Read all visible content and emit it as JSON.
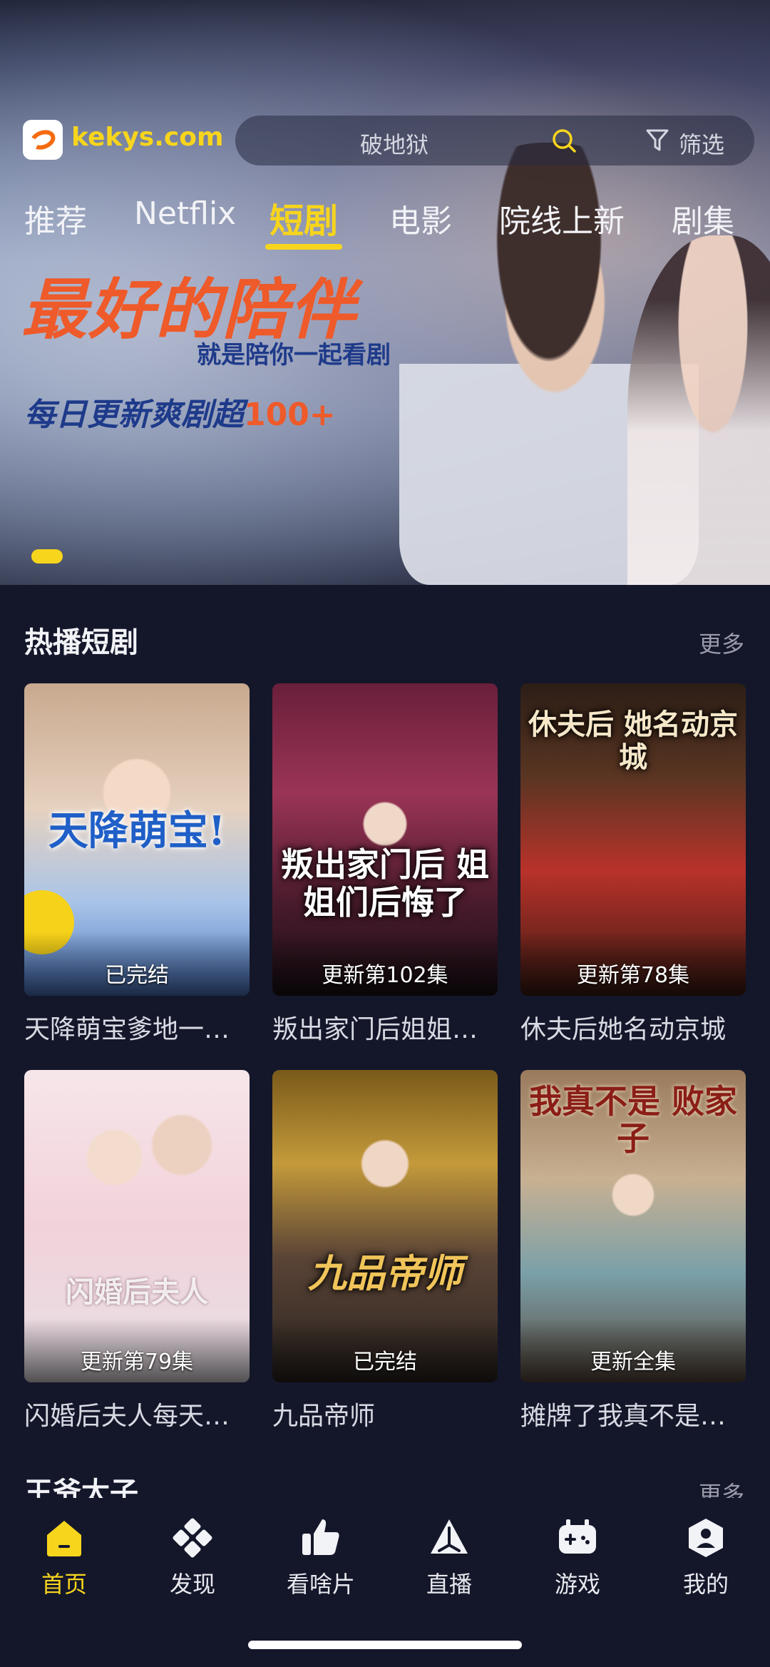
{
  "header": {
    "site_name": "kekys.com",
    "search_placeholder": "破地狱",
    "filter_label": "筛选"
  },
  "tabs": [
    {
      "label": "推荐",
      "active": false
    },
    {
      "label": "Netflix",
      "active": false
    },
    {
      "label": "短剧",
      "active": true
    },
    {
      "label": "电影",
      "active": false
    },
    {
      "label": "院线上新",
      "active": false
    },
    {
      "label": "剧集",
      "active": false
    }
  ],
  "banner": {
    "slogan_main": "最好的陪伴",
    "slogan_sub": "就是陪你一起看剧",
    "slogan_line": "每日更新爽剧超",
    "slogan_highlight": "100+"
  },
  "sections": [
    {
      "title": "热播短剧",
      "more": "更多",
      "items": [
        {
          "name": "天降萌宝爹地一…",
          "badge": "已完结",
          "poster_text": "天降萌宝!"
        },
        {
          "name": "叛出家门后姐姐…",
          "badge": "更新第102集",
          "poster_text": "叛出家门后 姐姐们后悔了"
        },
        {
          "name": "休夫后她名动京城",
          "badge": "更新第78集",
          "poster_text": "休夫后 她名动京城"
        },
        {
          "name": "闪婚后夫人每天…",
          "badge": "更新第79集",
          "poster_text": "闪婚后夫人"
        },
        {
          "name": "九品帝师",
          "badge": "已完结",
          "poster_text": "九品帝师"
        },
        {
          "name": "摊牌了我真不是…",
          "badge": "更新全集",
          "poster_text": "我真不是 败家子"
        }
      ]
    },
    {
      "title": "王爷太子",
      "more": "更多"
    }
  ],
  "bottom_nav": [
    {
      "label": "首页",
      "icon": "home-icon",
      "active": true
    },
    {
      "label": "发现",
      "icon": "discover-icon",
      "active": false
    },
    {
      "label": "看啥片",
      "icon": "thumbs-up-icon",
      "active": false
    },
    {
      "label": "直播",
      "icon": "live-icon",
      "active": false
    },
    {
      "label": "游戏",
      "icon": "gamepad-icon",
      "active": false
    },
    {
      "label": "我的",
      "icon": "profile-icon",
      "active": false
    }
  ],
  "colors": {
    "accent": "#f7d51d",
    "background": "#14172a",
    "brand_orange": "#ee5a2a"
  }
}
